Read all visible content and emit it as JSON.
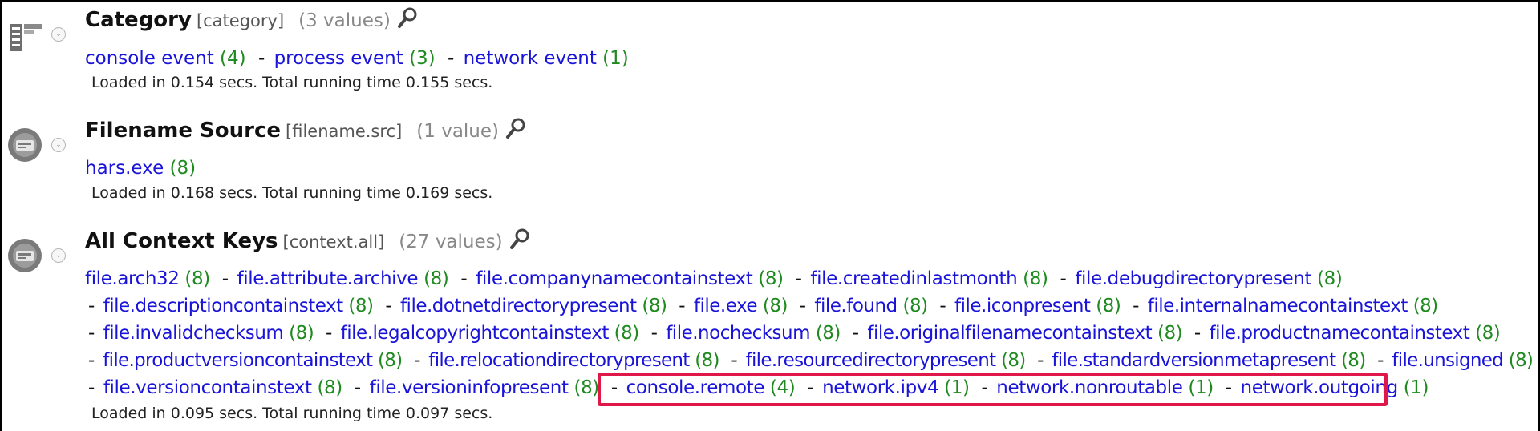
{
  "sections": [
    {
      "title": "Category",
      "key": "[category]",
      "count": "(3 values)",
      "icon": "category-list-icon",
      "values": [
        {
          "label": "console event",
          "count": "(4)"
        },
        {
          "label": "process event",
          "count": "(3)"
        },
        {
          "label": "network event",
          "count": "(1)"
        }
      ],
      "loaded": "Loaded in 0.154 secs. Total running time 0.155 secs."
    },
    {
      "title": "Filename Source",
      "key": "[filename.src]",
      "count": "(1 value)",
      "icon": "meta-key-icon",
      "values": [
        {
          "label": "hars.exe",
          "count": "(8)"
        }
      ],
      "loaded": "Loaded in 0.168 secs. Total running time 0.169 secs."
    },
    {
      "title": "All Context Keys",
      "key": "[context.all]",
      "count": "(27 values)",
      "icon": "meta-key-icon",
      "values": [
        {
          "label": "file.arch32",
          "count": "(8)"
        },
        {
          "label": "file.attribute.archive",
          "count": "(8)"
        },
        {
          "label": "file.companynamecontainstext",
          "count": "(8)"
        },
        {
          "label": "file.createdinlastmonth",
          "count": "(8)"
        },
        {
          "label": "file.debugdirectorypresent",
          "count": "(8)"
        },
        {
          "label": "file.descriptioncontainstext",
          "count": "(8)"
        },
        {
          "label": "file.dotnetdirectorypresent",
          "count": "(8)"
        },
        {
          "label": "file.exe",
          "count": "(8)"
        },
        {
          "label": "file.found",
          "count": "(8)"
        },
        {
          "label": "file.iconpresent",
          "count": "(8)"
        },
        {
          "label": "file.internalnamecontainstext",
          "count": "(8)"
        },
        {
          "label": "file.invalidchecksum",
          "count": "(8)"
        },
        {
          "label": "file.legalcopyrightcontainstext",
          "count": "(8)"
        },
        {
          "label": "file.nochecksum",
          "count": "(8)"
        },
        {
          "label": "file.originalfilenamecontainstext",
          "count": "(8)"
        },
        {
          "label": "file.productnamecontainstext",
          "count": "(8)"
        },
        {
          "label": "file.productversioncontainstext",
          "count": "(8)"
        },
        {
          "label": "file.relocationdirectorypresent",
          "count": "(8)"
        },
        {
          "label": "file.resourcedirectorypresent",
          "count": "(8)"
        },
        {
          "label": "file.standardversionmetapresent",
          "count": "(8)"
        },
        {
          "label": "file.unsigned",
          "count": "(8)"
        },
        {
          "label": "file.versioncontainstext",
          "count": "(8)"
        },
        {
          "label": "file.versioninfopresent",
          "count": "(8)"
        },
        {
          "label": "console.remote",
          "count": "(4)"
        },
        {
          "label": "network.ipv4",
          "count": "(1)"
        },
        {
          "label": "network.nonroutable",
          "count": "(1)"
        },
        {
          "label": "network.outgoing",
          "count": "(1)"
        }
      ],
      "highlighted_values": [
        "console.remote",
        "network.ipv4",
        "network.nonroutable",
        "network.outgoing"
      ],
      "loaded": "Loaded in 0.095 secs. Total running time 0.097 secs."
    }
  ],
  "separator": "-",
  "colors": {
    "value_link": "#1a14d8",
    "value_count": "#1f8a1f",
    "highlight_box": "#e0184a"
  }
}
